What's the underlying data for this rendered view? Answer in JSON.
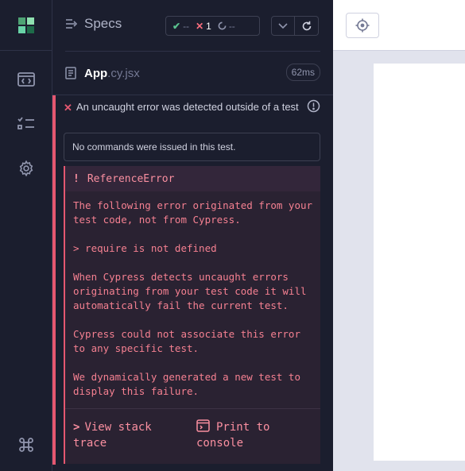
{
  "header": {
    "title": "Specs",
    "stats": {
      "passed": "--",
      "failed": "1",
      "pending": "--"
    }
  },
  "spec": {
    "name": "App",
    "ext": ".cy.jsx",
    "duration": "62ms"
  },
  "test": {
    "title": "An uncaught error was detected outside of a test",
    "no_commands": "No commands were issued in this test."
  },
  "error": {
    "bang": "!",
    "name": "ReferenceError",
    "paragraphs": [
      "The following error originated from your test code, not from Cypress.",
      "> require is not defined",
      "When Cypress detects uncaught errors originating from your test code it will automatically fail the current test.",
      "Cypress could not associate this error to any specific test.",
      "We dynamically generated a new test to display this failure."
    ],
    "view_stack": "View stack trace",
    "print_console": "Print to console"
  },
  "icons": {
    "logo": "cypress-logo-icon",
    "specs_nav": "browser-window-icon",
    "runs_nav": "list-checks-icon",
    "settings_nav": "gear-icon",
    "shortcuts_nav": "command-key-icon",
    "selector": "crosshair-icon"
  },
  "colors": {
    "accent_green": "#5ac18e",
    "error_red": "#e45770",
    "error_text": "#f58091"
  }
}
